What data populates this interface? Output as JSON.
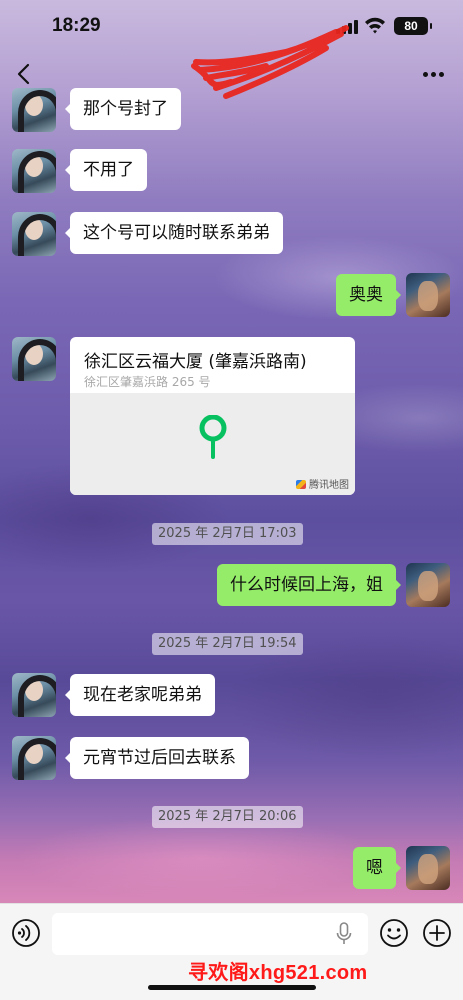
{
  "status_bar": {
    "time": "18:29",
    "battery": "80"
  },
  "nav": {
    "back_icon": "chevron-left-icon",
    "more_icon": "more-dots-icon"
  },
  "messages": [
    {
      "side": "left",
      "text": "那个号封了"
    },
    {
      "side": "left",
      "text": "不用了"
    },
    {
      "side": "left",
      "text": "这个号可以随时联系弟弟"
    },
    {
      "side": "right",
      "text": "奥奥"
    },
    {
      "side": "left",
      "type": "location",
      "title": "徐汇区云福大厦 (肇嘉浜路南)",
      "address": "徐汇区肇嘉浜路 265 号",
      "map_brand": "腾讯地图"
    },
    {
      "type": "timestamp",
      "text": "2025 年 2月7日 17:03"
    },
    {
      "side": "right",
      "text": "什么时候回上海，姐"
    },
    {
      "type": "timestamp",
      "text": "2025 年 2月7日 19:54"
    },
    {
      "side": "left",
      "text": "现在老家呢弟弟"
    },
    {
      "side": "left",
      "text": "元宵节过后回去联系"
    },
    {
      "type": "timestamp",
      "text": "2025 年 2月7日 20:06"
    },
    {
      "side": "right",
      "text": "嗯"
    }
  ],
  "input_bar": {
    "placeholder": "",
    "voice_icon": "voice-icon",
    "emoji_icon": "emoji-icon",
    "plus_icon": "plus-icon"
  },
  "watermark": "寻欢阁xhg521.com",
  "colors": {
    "bubble_right": "#95ec69",
    "bubble_left": "#ffffff",
    "pin": "#07c160",
    "watermark": "#ff1a1a"
  }
}
